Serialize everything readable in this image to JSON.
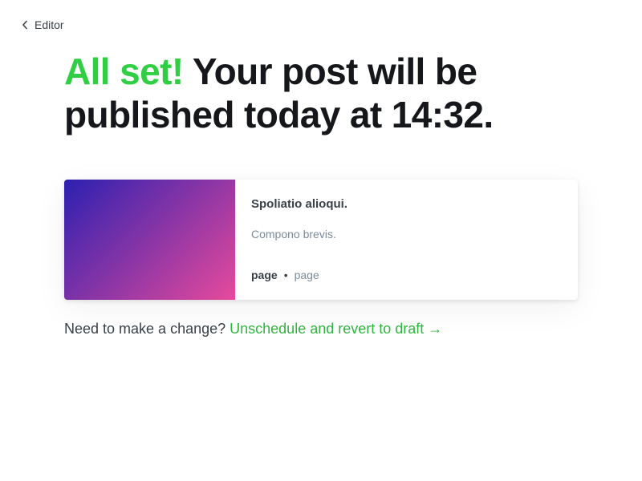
{
  "nav": {
    "back_label": "Editor"
  },
  "headline": {
    "accent": "All set!",
    "rest": " Your post will be published today at 14:32."
  },
  "post_card": {
    "title": "Spoliatio alioqui.",
    "excerpt": "Compono brevis.",
    "meta_primary": "page",
    "meta_separator": "•",
    "meta_secondary": "page",
    "gradient_start": "#2c20b0",
    "gradient_end": "#e64a9b"
  },
  "change": {
    "prompt": "Need to make a change? ",
    "link_label": "Unschedule and revert to draft →"
  },
  "colors": {
    "accent_green": "#30cf43",
    "link_green": "#2fb53f",
    "text_dark": "#15171a",
    "text_muted": "#7c8b9a"
  }
}
